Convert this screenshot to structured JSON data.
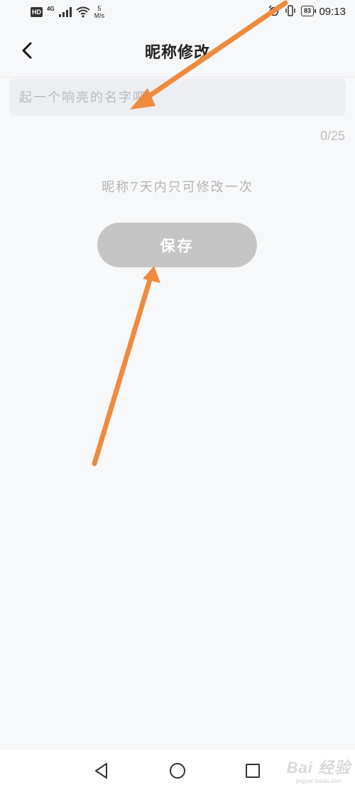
{
  "status_bar": {
    "hd": "HD",
    "network": "4G",
    "speed_value": "5",
    "speed_unit": "M/s",
    "battery": "83",
    "time": "09:13"
  },
  "header": {
    "title": "昵称修改",
    "back_icon": "chevron-left-icon"
  },
  "form": {
    "nickname_placeholder": "起一个响亮的名字吧",
    "nickname_value": "",
    "counter": "0/25",
    "hint": "昵称7天内只可修改一次",
    "save_label": "保存"
  },
  "navigation": {
    "back_icon": "triangle-back-icon",
    "home_icon": "circle-home-icon",
    "recents_icon": "square-recents-icon"
  },
  "watermark": {
    "main": "Bai 经验",
    "sub": "jingyan.baidu.com"
  },
  "colors": {
    "background": "#f7f8fa",
    "input_bg": "#eceef2",
    "button_disabled": "#c5c5c5",
    "annotation_arrow": "#f08a3c"
  }
}
